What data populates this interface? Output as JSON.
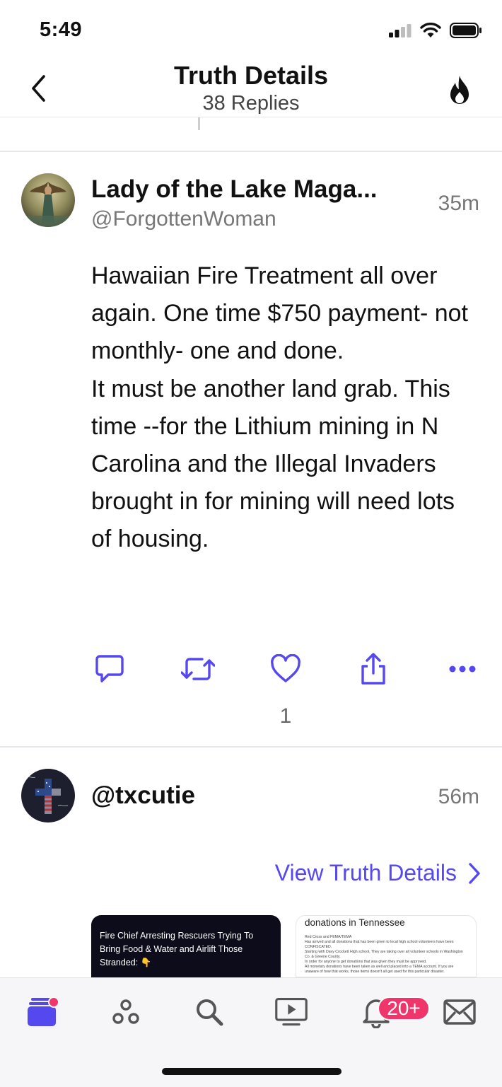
{
  "status_bar": {
    "time": "5:49"
  },
  "header": {
    "title": "Truth Details",
    "subtitle": "38 Replies"
  },
  "posts": [
    {
      "display_name": "Lady of the Lake Maga...",
      "handle": "@ForgottenWoman",
      "time": "35m",
      "body": "Hawaiian Fire Treatment all over again. One time $750 payment- not monthly- one and done.\nIt must be another land grab. This time --for the Lithium mining in N Carolina and the Illegal Invaders brought in for mining will need lots of housing.",
      "like_count": "1"
    },
    {
      "handle": "@txcutie",
      "time": "56m",
      "view_details": "View Truth Details",
      "media": [
        {
          "text": "Fire Chief Arresting Rescuers Trying To Bring Food & Water and Airlift Those Stranded: 👇"
        },
        {
          "title": "donations in Tennessee",
          "text": "Red Cross and FEMA/TEMA\nHas arrived and all donations that has been given to local high school volunteers have been CONFISCATED.\nStarting with Davy Crockett High school, They are taking over all volunteer schools in Washington Co. & Greene County.\nIn order for anyone to get donations that was given they must be approved.\nAll monetary donations have been taken as well and placed into a TEMA account. If you are unaware of how that works, those items doesn't all get used for this particular disaster."
        }
      ]
    }
  ],
  "tabbar": {
    "notification_badge": "20+"
  },
  "colors": {
    "accent": "#5448ee",
    "badge": "#f0356a"
  }
}
